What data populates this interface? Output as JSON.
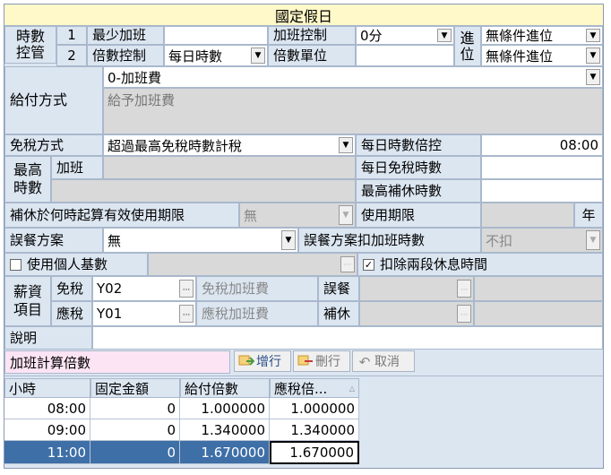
{
  "title": "國定假日",
  "overtime_control": {
    "group_label": "時數控管",
    "row1_no": "1",
    "row1_label": "最少加班",
    "row1_value": "",
    "row1_ctrl_label": "加班控制",
    "row1_ctrl_value": "0分",
    "row2_no": "2",
    "row2_label": "倍數控制",
    "row2_value": "每日時數",
    "row2_ctrl_label": "倍數單位",
    "row2_ctrl_value": "",
    "carry_label": "進位",
    "carry_1": "無條件進位",
    "carry_2": "無條件進位"
  },
  "payment": {
    "label": "給付方式",
    "value": "0-加班費",
    "note": "給予加班費"
  },
  "tax": {
    "label": "免稅方式",
    "value": "超過最高免稅時數計稅",
    "daily_ratio_label": "每日時數倍控",
    "daily_ratio_value": "08:00",
    "daily_taxfree_label": "每日免稅時數",
    "daily_taxfree_value": "",
    "max_comp_label": "最高補休時數",
    "max_comp_value": ""
  },
  "max_hours": {
    "label": "最高時數",
    "overtime_label": "加班",
    "overtime_value": ""
  },
  "comp_leave": {
    "label": "補休於何時起算有效使用期限",
    "value": "無",
    "period_label": "使用期限",
    "period_value": "",
    "unit": "年"
  },
  "meal": {
    "label": "誤餐方案",
    "value": "無",
    "deduct_label": "誤餐方案扣加班時數",
    "deduct_value": "不扣"
  },
  "options": {
    "personal_base_label": "使用個人基數",
    "personal_base_checked": "",
    "deduct_break_label": "扣除兩段休息時間",
    "deduct_break_checked": "✓"
  },
  "salary_items": {
    "label": "薪資項目",
    "taxfree_label": "免稅",
    "taxfree_value": "Y02",
    "taxfree_ot_label": "免稅加班費",
    "taxfree_ot_value": "",
    "meal_label": "誤餐",
    "meal_value": "",
    "taxable_label": "應稅",
    "taxable_value": "Y01",
    "taxable_ot_label": "應稅加班費",
    "taxable_ot_value": "",
    "comp_label": "補休",
    "comp_value": ""
  },
  "remark": {
    "label": "說明",
    "value": ""
  },
  "ratio_section": {
    "label": "加班計算倍數",
    "add_button": "增行",
    "delete_button": "刪行",
    "cancel_button": "取消"
  },
  "table": {
    "columns": [
      "小時",
      "固定金額",
      "給付倍數",
      "應稅倍..."
    ],
    "rows": [
      [
        "08:00",
        "0",
        "1.000000",
        "1.000000"
      ],
      [
        "09:00",
        "0",
        "1.340000",
        "1.340000"
      ],
      [
        "11:00",
        "0",
        "1.670000",
        "1.670000"
      ]
    ]
  },
  "colors": {
    "panel": "#dce6f1",
    "title_bar": "#fff8c8",
    "selected_row": "#3e6fa7",
    "section_label": "#fde4f4"
  }
}
